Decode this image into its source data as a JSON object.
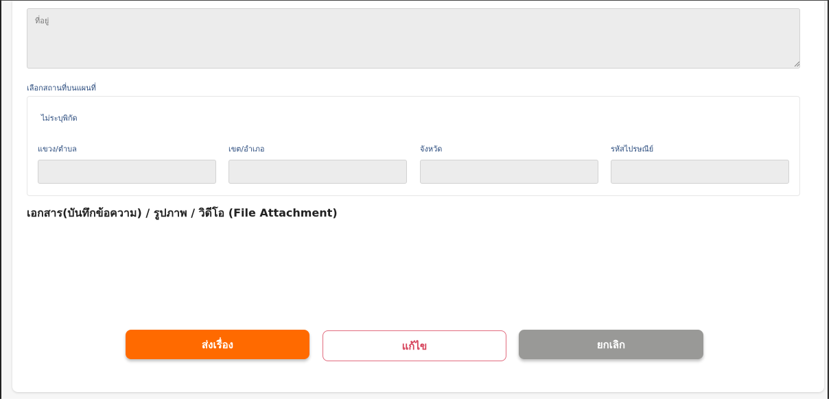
{
  "address": {
    "placeholder": "ที่อยู่",
    "value": ""
  },
  "map": {
    "link_label": "เลือกสถานที่บนแผนที่"
  },
  "location_panel": {
    "no_coordinates_label": "ไม่ระบุพิกัด",
    "fields": [
      {
        "label": "แขวง/ตำบล",
        "value": ""
      },
      {
        "label": "เขต/อำเภอ",
        "value": ""
      },
      {
        "label": "จังหวัด",
        "value": ""
      },
      {
        "label": "รหัสไปรษณีย์",
        "value": ""
      }
    ]
  },
  "attachments": {
    "title": "เอกสาร(บันทึกข้อความ) / รูปภาพ / วิดีโอ (File Attachment)"
  },
  "actions": {
    "submit_label": "ส่งเรื่อง",
    "edit_label": "แก้ไข",
    "cancel_label": "ยกเลิก"
  },
  "colors": {
    "submit": "#ff6a00",
    "edit_border": "#e16b7e",
    "edit_text": "#d6425a",
    "cancel": "#999997",
    "label_text": "#2b4c7e",
    "input_bg": "#ececec"
  },
  "icons": {
    "resize_grip": "resize-grip-icon"
  }
}
